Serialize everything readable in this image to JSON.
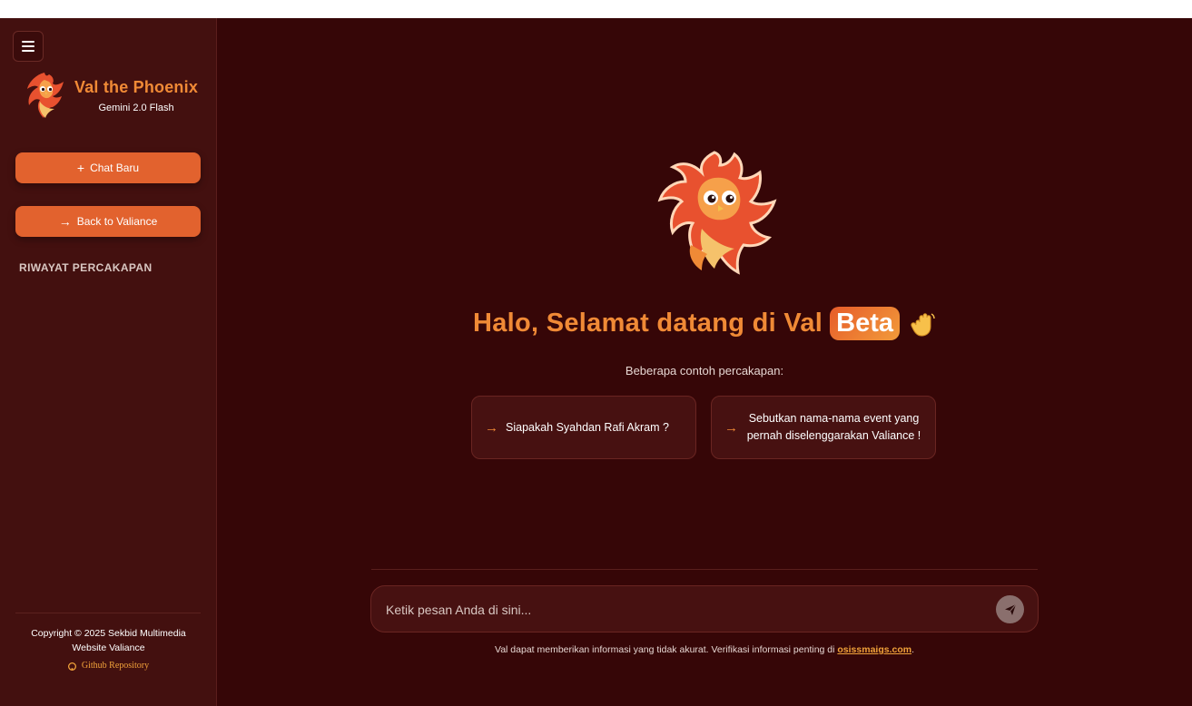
{
  "sidebar": {
    "brand_title": "Val the Phoenix",
    "brand_model": "Gemini 2.0 Flash",
    "new_chat_label": "Chat Baru",
    "back_label": "Back to Valiance",
    "history_title": "RIWAYAT PERCAKAPAN",
    "footer_copyright": "Copyright © 2025 Sekbid Multimedia",
    "footer_site": "Website Valiance",
    "github_label": "Github Repository"
  },
  "main": {
    "greeting": "Halo, Selamat datang di Val",
    "beta_badge": "Beta",
    "examples_title": "Beberapa contoh percakapan:",
    "examples": [
      {
        "text": "Siapakah Syahdan Rafi Akram ?"
      },
      {
        "text": "Sebutkan nama-nama event yang pernah diselenggarakan Valiance !"
      }
    ],
    "input_placeholder": "Ketik pesan Anda di sini...",
    "disclaimer_prefix": "Val dapat memberikan informasi yang tidak akurat. Verifikasi informasi penting di ",
    "disclaimer_link": "osissmaigs.com",
    "disclaimer_suffix": "."
  },
  "icons": {
    "menu": "hamburger-menu-icon",
    "new_chat": "plus-icon",
    "back": "arrow-right-icon",
    "github": "github-icon",
    "wave": "waving-hand-icon",
    "send": "paper-plane-icon",
    "example_arrow": "arrow-right-icon"
  },
  "colors": {
    "accent": "#f08a36",
    "button": "#e2622e",
    "background": "#360607",
    "sidebar": "#43100f",
    "link": "#f1a23a"
  }
}
